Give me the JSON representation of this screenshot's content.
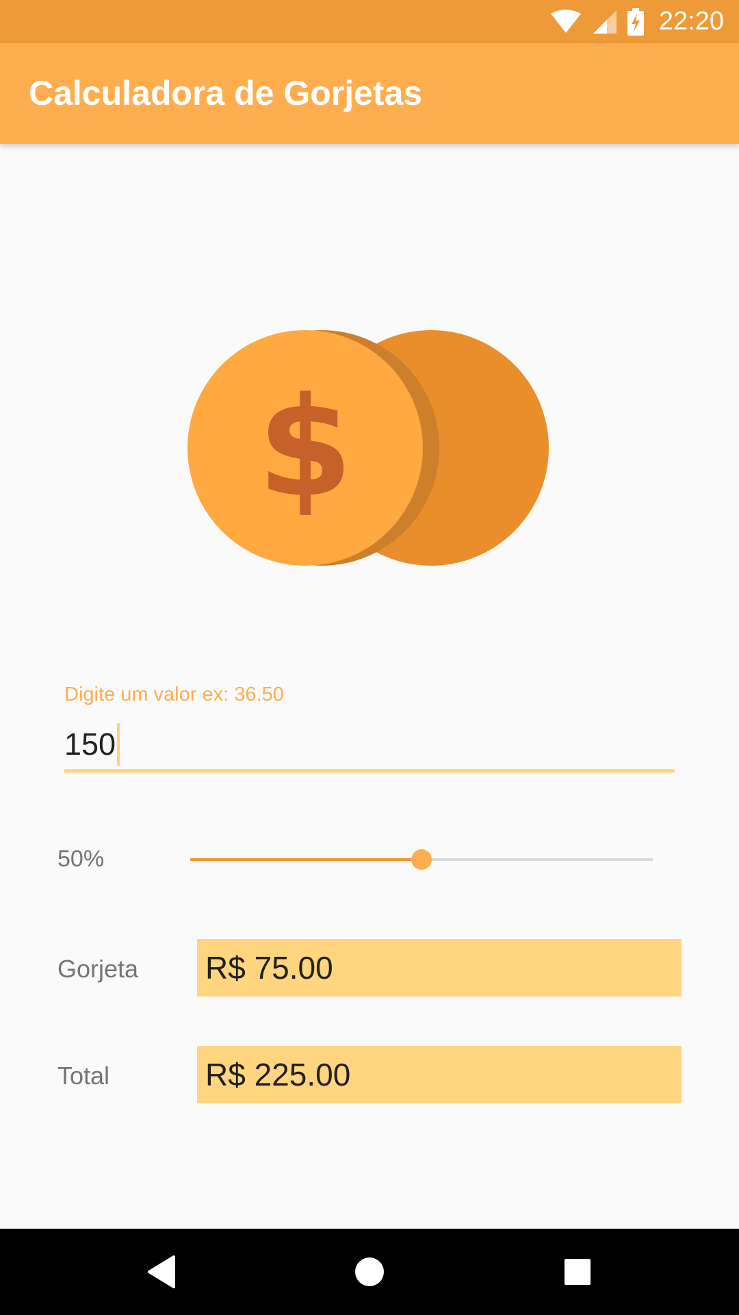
{
  "status_bar": {
    "time": "22:20",
    "icons": [
      "wifi-icon",
      "cell-signal-icon",
      "battery-charging-icon"
    ]
  },
  "app_bar": {
    "title": "Calculadora de Gorjetas"
  },
  "illustration": {
    "icon": "coins-dollar-icon",
    "symbol": "$"
  },
  "bill_input": {
    "label": "Digite um valor ex: 36.50",
    "value": "150"
  },
  "tip_slider": {
    "label": "50%",
    "value_percent": 50
  },
  "results": {
    "tip_label": "Gorjeta",
    "tip_value": "R$ 75.00",
    "total_label": "Total",
    "total_value": "R$ 225.00"
  },
  "nav_bar": {
    "buttons": [
      "back-icon",
      "home-icon",
      "recents-icon"
    ]
  },
  "colors": {
    "status_bar": "#ef9a39",
    "app_bar": "#ffae4f",
    "accent": "#ffae4f",
    "result_background": "#ffd67f",
    "coin_front": "#ffa940",
    "coin_back": "#ea8e2c",
    "dollar_sign": "#c8602a"
  }
}
